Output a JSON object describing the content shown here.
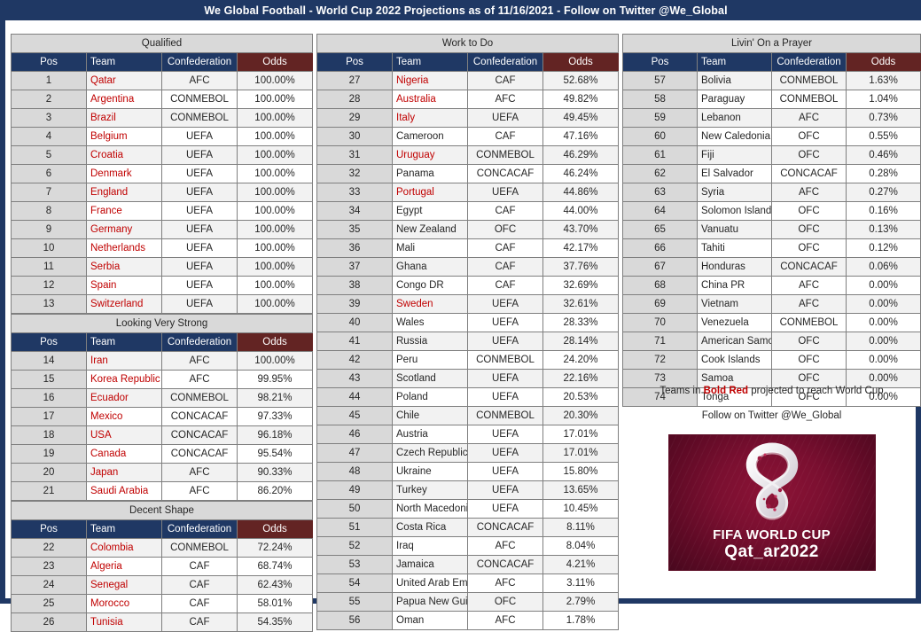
{
  "title": "We Global Football - World Cup 2022 Projections as of 11/16/2021 - Follow on Twitter @We_Global",
  "colors": {
    "header_blue": "#1F3864",
    "odds_maroon": "#632423",
    "section_gray": "#D9D9D9",
    "qualified_red": "#C00000"
  },
  "columns": {
    "headers": {
      "pos": "Pos",
      "team": "Team",
      "confederation": "Confederation",
      "odds": "Odds"
    },
    "sections": [
      {
        "name": "Qualified",
        "column": 1,
        "rows": [
          {
            "pos": "1",
            "team": "Qatar",
            "conf": "AFC",
            "odds": "100.00%",
            "red": true
          },
          {
            "pos": "2",
            "team": "Argentina",
            "conf": "CONMEBOL",
            "odds": "100.00%",
            "red": true
          },
          {
            "pos": "3",
            "team": "Brazil",
            "conf": "CONMEBOL",
            "odds": "100.00%",
            "red": true
          },
          {
            "pos": "4",
            "team": "Belgium",
            "conf": "UEFA",
            "odds": "100.00%",
            "red": true
          },
          {
            "pos": "5",
            "team": "Croatia",
            "conf": "UEFA",
            "odds": "100.00%",
            "red": true
          },
          {
            "pos": "6",
            "team": "Denmark",
            "conf": "UEFA",
            "odds": "100.00%",
            "red": true
          },
          {
            "pos": "7",
            "team": "England",
            "conf": "UEFA",
            "odds": "100.00%",
            "red": true
          },
          {
            "pos": "8",
            "team": "France",
            "conf": "UEFA",
            "odds": "100.00%",
            "red": true
          },
          {
            "pos": "9",
            "team": "Germany",
            "conf": "UEFA",
            "odds": "100.00%",
            "red": true
          },
          {
            "pos": "10",
            "team": "Netherlands",
            "conf": "UEFA",
            "odds": "100.00%",
            "red": true
          },
          {
            "pos": "11",
            "team": "Serbia",
            "conf": "UEFA",
            "odds": "100.00%",
            "red": true
          },
          {
            "pos": "12",
            "team": "Spain",
            "conf": "UEFA",
            "odds": "100.00%",
            "red": true
          },
          {
            "pos": "13",
            "team": "Switzerland",
            "conf": "UEFA",
            "odds": "100.00%",
            "red": true
          }
        ]
      },
      {
        "name": "Looking Very Strong",
        "column": 1,
        "rows": [
          {
            "pos": "14",
            "team": "Iran",
            "conf": "AFC",
            "odds": "100.00%",
            "red": true
          },
          {
            "pos": "15",
            "team": "Korea Republic",
            "conf": "AFC",
            "odds": "99.95%",
            "red": true
          },
          {
            "pos": "16",
            "team": "Ecuador",
            "conf": "CONMEBOL",
            "odds": "98.21%",
            "red": true
          },
          {
            "pos": "17",
            "team": "Mexico",
            "conf": "CONCACAF",
            "odds": "97.33%",
            "red": true
          },
          {
            "pos": "18",
            "team": "USA",
            "conf": "CONCACAF",
            "odds": "96.18%",
            "red": true
          },
          {
            "pos": "19",
            "team": "Canada",
            "conf": "CONCACAF",
            "odds": "95.54%",
            "red": true
          },
          {
            "pos": "20",
            "team": "Japan",
            "conf": "AFC",
            "odds": "90.33%",
            "red": true
          },
          {
            "pos": "21",
            "team": "Saudi Arabia",
            "conf": "AFC",
            "odds": "86.20%",
            "red": true
          }
        ]
      },
      {
        "name": "Decent Shape",
        "column": 1,
        "rows": [
          {
            "pos": "22",
            "team": "Colombia",
            "conf": "CONMEBOL",
            "odds": "72.24%",
            "red": true
          },
          {
            "pos": "23",
            "team": "Algeria",
            "conf": "CAF",
            "odds": "68.74%",
            "red": true
          },
          {
            "pos": "24",
            "team": "Senegal",
            "conf": "CAF",
            "odds": "62.43%",
            "red": true
          },
          {
            "pos": "25",
            "team": "Morocco",
            "conf": "CAF",
            "odds": "58.01%",
            "red": true
          },
          {
            "pos": "26",
            "team": "Tunisia",
            "conf": "CAF",
            "odds": "54.35%",
            "red": true
          }
        ]
      },
      {
        "name": "Work to Do",
        "column": 2,
        "rows": [
          {
            "pos": "27",
            "team": "Nigeria",
            "conf": "CAF",
            "odds": "52.68%",
            "red": true
          },
          {
            "pos": "28",
            "team": "Australia",
            "conf": "AFC",
            "odds": "49.82%",
            "red": true
          },
          {
            "pos": "29",
            "team": "Italy",
            "conf": "UEFA",
            "odds": "49.45%",
            "red": true
          },
          {
            "pos": "30",
            "team": "Cameroon",
            "conf": "CAF",
            "odds": "47.16%",
            "red": false
          },
          {
            "pos": "31",
            "team": "Uruguay",
            "conf": "CONMEBOL",
            "odds": "46.29%",
            "red": true
          },
          {
            "pos": "32",
            "team": "Panama",
            "conf": "CONCACAF",
            "odds": "46.24%",
            "red": false
          },
          {
            "pos": "33",
            "team": "Portugal",
            "conf": "UEFA",
            "odds": "44.86%",
            "red": true
          },
          {
            "pos": "34",
            "team": "Egypt",
            "conf": "CAF",
            "odds": "44.00%",
            "red": false
          },
          {
            "pos": "35",
            "team": "New Zealand",
            "conf": "OFC",
            "odds": "43.70%",
            "red": false
          },
          {
            "pos": "36",
            "team": "Mali",
            "conf": "CAF",
            "odds": "42.17%",
            "red": false
          },
          {
            "pos": "37",
            "team": "Ghana",
            "conf": "CAF",
            "odds": "37.76%",
            "red": false
          },
          {
            "pos": "38",
            "team": "Congo DR",
            "conf": "CAF",
            "odds": "32.69%",
            "red": false
          },
          {
            "pos": "39",
            "team": "Sweden",
            "conf": "UEFA",
            "odds": "32.61%",
            "red": true
          },
          {
            "pos": "40",
            "team": "Wales",
            "conf": "UEFA",
            "odds": "28.33%",
            "red": false
          },
          {
            "pos": "41",
            "team": "Russia",
            "conf": "UEFA",
            "odds": "28.14%",
            "red": false
          },
          {
            "pos": "42",
            "team": "Peru",
            "conf": "CONMEBOL",
            "odds": "24.20%",
            "red": false
          },
          {
            "pos": "43",
            "team": "Scotland",
            "conf": "UEFA",
            "odds": "22.16%",
            "red": false
          },
          {
            "pos": "44",
            "team": "Poland",
            "conf": "UEFA",
            "odds": "20.53%",
            "red": false
          },
          {
            "pos": "45",
            "team": "Chile",
            "conf": "CONMEBOL",
            "odds": "20.30%",
            "red": false
          },
          {
            "pos": "46",
            "team": "Austria",
            "conf": "UEFA",
            "odds": "17.01%",
            "red": false
          },
          {
            "pos": "47",
            "team": "Czech Republic",
            "conf": "UEFA",
            "odds": "17.01%",
            "red": false
          },
          {
            "pos": "48",
            "team": "Ukraine",
            "conf": "UEFA",
            "odds": "15.80%",
            "red": false
          },
          {
            "pos": "49",
            "team": "Turkey",
            "conf": "UEFA",
            "odds": "13.65%",
            "red": false
          },
          {
            "pos": "50",
            "team": "North Macedonia",
            "conf": "UEFA",
            "odds": "10.45%",
            "red": false
          },
          {
            "pos": "51",
            "team": "Costa Rica",
            "conf": "CONCACAF",
            "odds": "8.11%",
            "red": false
          },
          {
            "pos": "52",
            "team": "Iraq",
            "conf": "AFC",
            "odds": "8.04%",
            "red": false
          },
          {
            "pos": "53",
            "team": "Jamaica",
            "conf": "CONCACAF",
            "odds": "4.21%",
            "red": false
          },
          {
            "pos": "54",
            "team": "United Arab Emirates",
            "conf": "AFC",
            "odds": "3.11%",
            "red": false
          },
          {
            "pos": "55",
            "team": "Papua New Guinea",
            "conf": "OFC",
            "odds": "2.79%",
            "red": false
          },
          {
            "pos": "56",
            "team": "Oman",
            "conf": "AFC",
            "odds": "1.78%",
            "red": false
          }
        ]
      },
      {
        "name": "Livin' On a Prayer",
        "column": 3,
        "rows": [
          {
            "pos": "57",
            "team": "Bolivia",
            "conf": "CONMEBOL",
            "odds": "1.63%",
            "red": false
          },
          {
            "pos": "58",
            "team": "Paraguay",
            "conf": "CONMEBOL",
            "odds": "1.04%",
            "red": false
          },
          {
            "pos": "59",
            "team": "Lebanon",
            "conf": "AFC",
            "odds": "0.73%",
            "red": false
          },
          {
            "pos": "60",
            "team": "New Caledonia",
            "conf": "OFC",
            "odds": "0.55%",
            "red": false
          },
          {
            "pos": "61",
            "team": "Fiji",
            "conf": "OFC",
            "odds": "0.46%",
            "red": false
          },
          {
            "pos": "62",
            "team": "El Salvador",
            "conf": "CONCACAF",
            "odds": "0.28%",
            "red": false
          },
          {
            "pos": "63",
            "team": "Syria",
            "conf": "AFC",
            "odds": "0.27%",
            "red": false
          },
          {
            "pos": "64",
            "team": "Solomon Islands",
            "conf": "OFC",
            "odds": "0.16%",
            "red": false
          },
          {
            "pos": "65",
            "team": "Vanuatu",
            "conf": "OFC",
            "odds": "0.13%",
            "red": false
          },
          {
            "pos": "66",
            "team": "Tahiti",
            "conf": "OFC",
            "odds": "0.12%",
            "red": false
          },
          {
            "pos": "67",
            "team": "Honduras",
            "conf": "CONCACAF",
            "odds": "0.06%",
            "red": false
          },
          {
            "pos": "68",
            "team": "China PR",
            "conf": "AFC",
            "odds": "0.00%",
            "red": false
          },
          {
            "pos": "69",
            "team": "Vietnam",
            "conf": "AFC",
            "odds": "0.00%",
            "red": false
          },
          {
            "pos": "70",
            "team": "Venezuela",
            "conf": "CONMEBOL",
            "odds": "0.00%",
            "red": false
          },
          {
            "pos": "71",
            "team": "American Samoa",
            "conf": "OFC",
            "odds": "0.00%",
            "red": false
          },
          {
            "pos": "72",
            "team": "Cook Islands",
            "conf": "OFC",
            "odds": "0.00%",
            "red": false
          },
          {
            "pos": "73",
            "team": "Samoa",
            "conf": "OFC",
            "odds": "0.00%",
            "red": false
          },
          {
            "pos": "74",
            "team": "Tonga",
            "conf": "OFC",
            "odds": "0.00%",
            "red": false
          }
        ]
      }
    ]
  },
  "legend": {
    "line1_pre": "Teams in ",
    "line1_em": "Bold Red",
    "line1_post": " projected to reach World Cup",
    "line2": "Follow on Twitter @We_Global"
  },
  "logo": {
    "line1": "FIFA WORLD CUP",
    "line2": "Qat_ar2022"
  }
}
